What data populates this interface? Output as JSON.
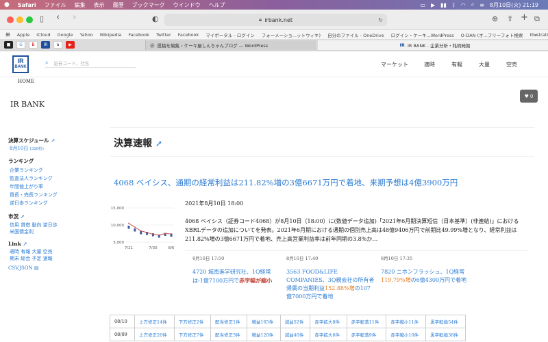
{
  "menubar": {
    "apple": "",
    "items": [
      "Safari",
      "ファイル",
      "編集",
      "表示",
      "履歴",
      "ブックマーク",
      "ウインドウ",
      "ヘルプ"
    ],
    "clock": "8月10日(火)  21:19"
  },
  "browser": {
    "url": "irbank.net",
    "bookmarks": [
      "Apple",
      "iCloud",
      "Google",
      "Yahoo",
      "Wikipedia",
      "Facebook",
      "Twitter",
      "Facebook",
      "マイポータル - ログイン",
      "フォーメーショ...ットウィキ)",
      "自分のファイル - OneDrive",
      "ログイン・ケーキ...WordPress",
      "O-DAN (オ...フリーフォト検索",
      "Illustrations | unDraw"
    ],
    "tabs": [
      {
        "label": "投稿を編集 ‹ ケーキ屋しんちゃんブログ — WordPress"
      },
      {
        "label": "IR BANK - 企業分析・銘柄発掘"
      }
    ]
  },
  "site": {
    "logo_line1": "IR",
    "logo_line2": "BANK",
    "search_placeholder": "証券コード、社名",
    "nav": [
      "マーケット",
      "適時",
      "有報",
      "大量",
      "空売"
    ],
    "breadcrumb": "HOME",
    "site_title": "IR BANK",
    "fav_count": "0"
  },
  "sidebar": {
    "schedule_heading": "決算スケジュール",
    "schedule_date": "8月10日",
    "schedule_count": "(326社)",
    "ranking_heading": "ランキング",
    "ranking_items": [
      "企業ランキング",
      "監査法人ランキング",
      "年間値上がり率",
      "買長・売長ランキング",
      "逆日歩ランキング"
    ],
    "credit_heading": "市況",
    "credit_line1": "信用  貸借  動向  逆日歩",
    "credit_line2": "米国債金利",
    "link_heading": "Link",
    "link_line1": "適時  有報  大量  空売",
    "link_line2": "期末  総会  予定  速報",
    "csv_json": "CSV,JSON"
  },
  "main": {
    "page_title": "決算速報",
    "headline": "4068 ベイシス、通期の経常利益は211.82%増の3億6671万円で着地、来期予想は4億3900万円",
    "datetime": "2021年8月10日 18:00",
    "body": "4068 ベイシス（証券コード4068）が8月10日（18:00）に(数値データ追加)「2021年6月期決算短信〔日本基準〕(非連結)」におけるXBRLデータの追加についてを発表。2021年6月期における通期の個別売上高は48億9406万円で前期比49.99%増となり、経常利益は211.82%増の3億6671万円で着地、売上高営業利益率は前年同期の3.8%か…",
    "related": [
      {
        "time": "8月10日 17:50",
        "text_pre": "4720 城南進学研究社、1Q経常は-1億7100万円で",
        "highlight": "赤字幅が縮小",
        "text_post": "",
        "hl_color": "#c0392b"
      },
      {
        "time": "8月10日 17:40",
        "text_pre": "3563 FOOD&LIFE COMPANIES、3Q親会社の所有者帰属の当期利益",
        "highlight": "152.88%増",
        "text_post": "の107億7000万円で着地",
        "hl_color": "#e67e22"
      },
      {
        "time": "8月10日 17:35",
        "text_pre": "7820 ニホンフラッシュ、1Q経常",
        "highlight": "119.79%増",
        "text_post": "の6億4300万円で着地",
        "hl_color": "#e67e22"
      }
    ],
    "table_rows": [
      {
        "date": "08/10",
        "cells": [
          "上方修正14件",
          "下方修正2件",
          "配当修正1件",
          "増益165件",
          "減益52件",
          "赤字拡大8件",
          "赤字転落11件",
          "赤字縮小11件",
          "黒字転換54件"
        ]
      },
      {
        "date": "08/09",
        "cells": [
          "上方修正20件",
          "下方修正7件",
          "配当修正3件",
          "増益120件",
          "減益40件",
          "赤字拡大6件",
          "赤字転落9件",
          "赤字縮小10件",
          "黒字転換38件"
        ]
      }
    ]
  },
  "chart_data": {
    "type": "line",
    "title": "",
    "xlabel": "",
    "ylabel": "",
    "x": [
      "7/21",
      "7/23",
      "7/26",
      "7/28",
      "7/30",
      "8/3",
      "8/5",
      "8/6"
    ],
    "yticks": [
      "15,000",
      "10,000",
      "5,000"
    ],
    "xticks": [
      "7/21",
      "7/30",
      "8/6"
    ],
    "ylim": [
      5000,
      15000
    ],
    "series": [
      {
        "values": [
          10500,
          9400,
          8300,
          7800,
          7300,
          7100,
          7500,
          7400
        ]
      }
    ],
    "bars": [
      9800,
      9000,
      8200,
      8000,
      7600,
      7200,
      7700,
      7500
    ],
    "colors": {
      "line": "#c0504d",
      "bar": "#3a5ba0"
    }
  }
}
